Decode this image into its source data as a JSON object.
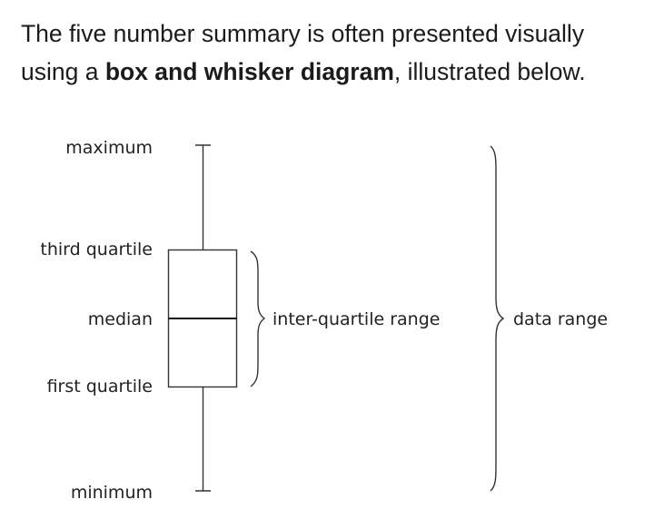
{
  "intro": {
    "part1": "The five number summary is often presented visually using a ",
    "bold": "box and whisker diagram",
    "part2": ", illustrated below."
  },
  "diagram": {
    "labels": {
      "maximum": "maximum",
      "third_quartile": "third quartile",
      "median": "median",
      "first_quartile": "first quartile",
      "minimum": "minimum"
    },
    "brackets": {
      "iqr": "inter-quartile range",
      "data_range": "data range"
    }
  }
}
